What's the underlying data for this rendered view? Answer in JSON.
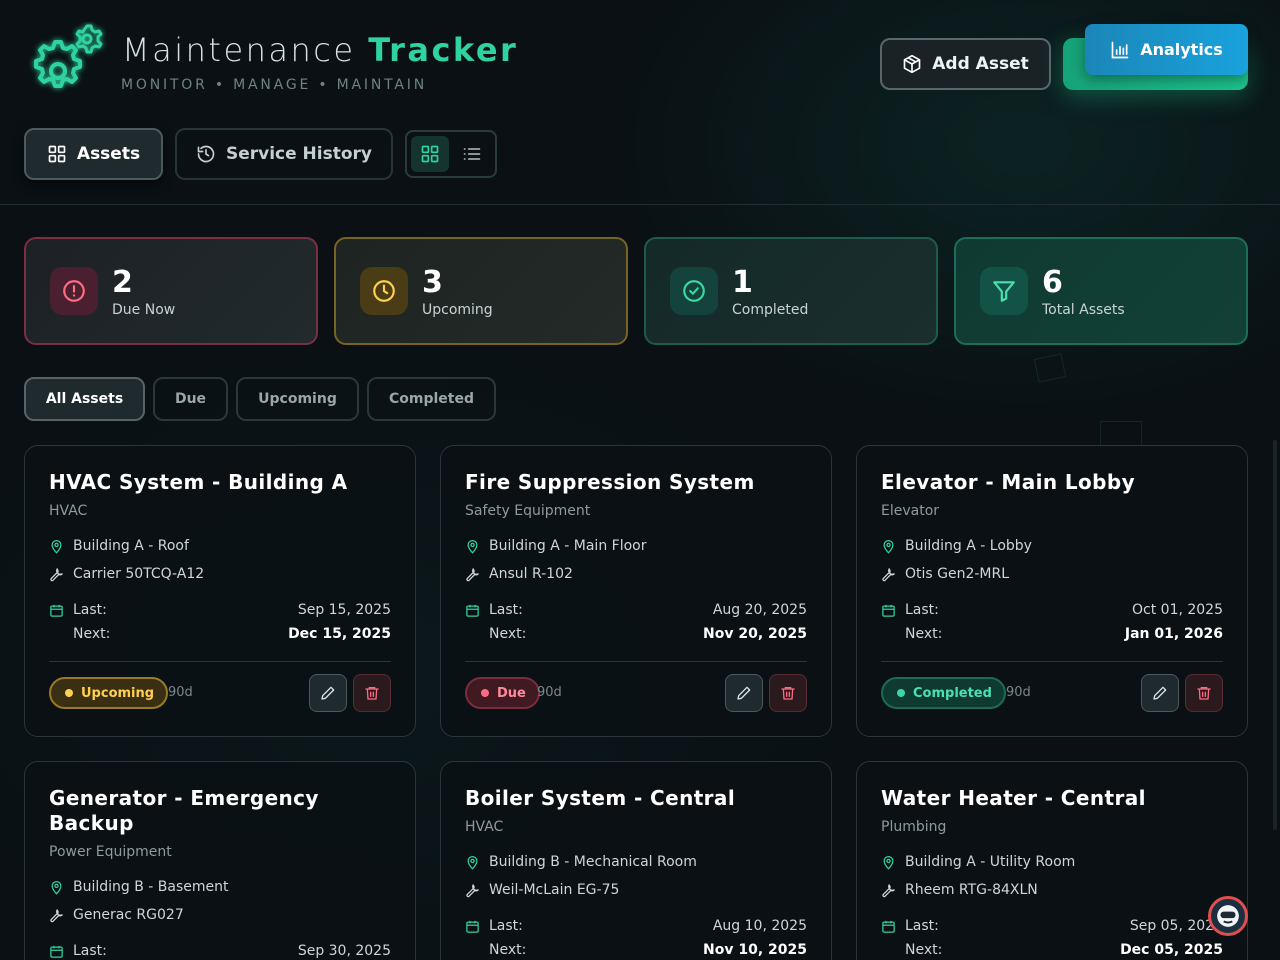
{
  "app": {
    "title_main": "Maintenance",
    "title_accent": "Tracker",
    "subtitle": "MONITOR • MANAGE • MAINTAIN"
  },
  "header_actions": {
    "add_asset": "Add Asset",
    "analytics": "Analytics"
  },
  "tabs": [
    {
      "label": "Assets",
      "active": true
    },
    {
      "label": "Service History",
      "active": false
    }
  ],
  "stats": [
    {
      "value": "2",
      "label": "Due Now"
    },
    {
      "value": "3",
      "label": "Upcoming"
    },
    {
      "value": "1",
      "label": "Completed"
    },
    {
      "value": "6",
      "label": "Total Assets"
    }
  ],
  "filters": [
    {
      "label": "All Assets",
      "active": true
    },
    {
      "label": "Due",
      "active": false
    },
    {
      "label": "Upcoming",
      "active": false
    },
    {
      "label": "Completed",
      "active": false
    }
  ],
  "labels": {
    "last": "Last:",
    "next": "Next:"
  },
  "assets": [
    {
      "name": "HVAC System - Building A",
      "category": "HVAC",
      "location": "Building A - Roof",
      "model": "Carrier 50TCQ-A12",
      "last": "Sep 15, 2025",
      "next": "Dec 15, 2025",
      "status": "Upcoming",
      "interval": "90d"
    },
    {
      "name": "Fire Suppression System",
      "category": "Safety Equipment",
      "location": "Building A - Main Floor",
      "model": "Ansul R-102",
      "last": "Aug 20, 2025",
      "next": "Nov 20, 2025",
      "status": "Due",
      "interval": "90d"
    },
    {
      "name": "Elevator - Main Lobby",
      "category": "Elevator",
      "location": "Building A - Lobby",
      "model": "Otis Gen2-MRL",
      "last": "Oct 01, 2025",
      "next": "Jan 01, 2026",
      "status": "Completed",
      "interval": "90d"
    },
    {
      "name": "Generator - Emergency Backup",
      "category": "Power Equipment",
      "location": "Building B - Basement",
      "model": "Generac RG027",
      "last": "Sep 30, 2025",
      "next": "",
      "status": "",
      "interval": ""
    },
    {
      "name": "Boiler System - Central",
      "category": "HVAC",
      "location": "Building B - Mechanical Room",
      "model": "Weil-McLain EG-75",
      "last": "Aug 10, 2025",
      "next": "Nov 10, 2025",
      "status": "",
      "interval": ""
    },
    {
      "name": "Water Heater - Central",
      "category": "Plumbing",
      "location": "Building A - Utility Room",
      "model": "Rheem RTG-84XLN",
      "last": "Sep 05, 2025",
      "next": "Dec 05, 2025",
      "status": "",
      "interval": ""
    }
  ],
  "colors": {
    "accent": "#2fd3a0",
    "due": "#ff6b82",
    "upcoming": "#ffcf4f",
    "completed": "#3ad6a5",
    "analytics": "#1aa2dc"
  }
}
